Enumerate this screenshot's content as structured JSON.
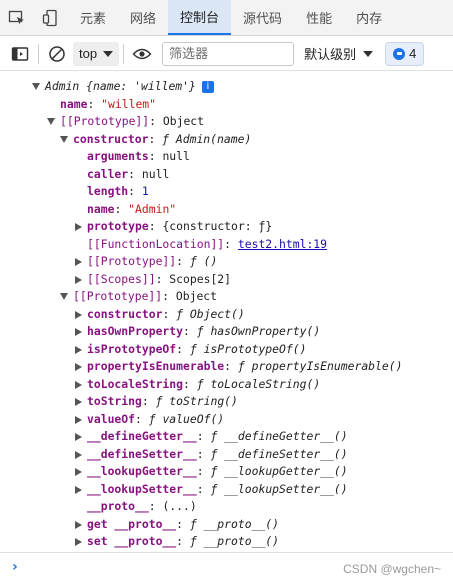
{
  "tabs": [
    {
      "label": "元素"
    },
    {
      "label": "网络"
    },
    {
      "label": "控制台"
    },
    {
      "label": "源代码"
    },
    {
      "label": "性能"
    },
    {
      "label": "内存"
    }
  ],
  "toolbar": {
    "context": "top",
    "filter_placeholder": "筛选器",
    "levels_label": "默认级别",
    "message_count": "4"
  },
  "console": {
    "root_summary": "Admin {name: 'willem'}",
    "info_badge": "i",
    "name_key": "name",
    "name_value": "\"willem\"",
    "proto_key": "[[Prototype]]",
    "object_value": "Object",
    "constructor_key": "constructor",
    "admin_fn": "ƒ Admin(name)",
    "arguments_key": "arguments",
    "caller_key": "caller",
    "null_value": "null",
    "length_key": "length",
    "length_value": "1",
    "admin_name_value": "\"Admin\"",
    "prototype_key": "prototype",
    "prototype_value": "{constructor: ƒ}",
    "function_location_key": "[[FunctionLocation]]",
    "function_location_link": "test2.html:19",
    "fn_proto_value": "ƒ ()",
    "scopes_key": "[[Scopes]]",
    "scopes_value": "Scopes[2]",
    "object_members": [
      {
        "key": "constructor",
        "value": "ƒ Object()"
      },
      {
        "key": "hasOwnProperty",
        "value": "ƒ hasOwnProperty()"
      },
      {
        "key": "isPrototypeOf",
        "value": "ƒ isPrototypeOf()"
      },
      {
        "key": "propertyIsEnumerable",
        "value": "ƒ propertyIsEnumerable()"
      },
      {
        "key": "toLocaleString",
        "value": "ƒ toLocaleString()"
      },
      {
        "key": "toString",
        "value": "ƒ toString()"
      },
      {
        "key": "valueOf",
        "value": "ƒ valueOf()"
      },
      {
        "key": "__defineGetter__",
        "value": "ƒ __defineGetter__()"
      },
      {
        "key": "__defineSetter__",
        "value": "ƒ __defineSetter__()"
      },
      {
        "key": "__lookupGetter__",
        "value": "ƒ __lookupGetter__()"
      },
      {
        "key": "__lookupSetter__",
        "value": "ƒ __lookupSetter__()"
      }
    ],
    "proto_accessor_key": "__proto__",
    "proto_accessor_value": "(...)",
    "get_proto_key": "get __proto__",
    "set_proto_key": "set __proto__",
    "proto_fn_value": "ƒ __proto__()"
  },
  "prompt": {
    "chevron": "›"
  },
  "watermark": "CSDN @wgchen~"
}
